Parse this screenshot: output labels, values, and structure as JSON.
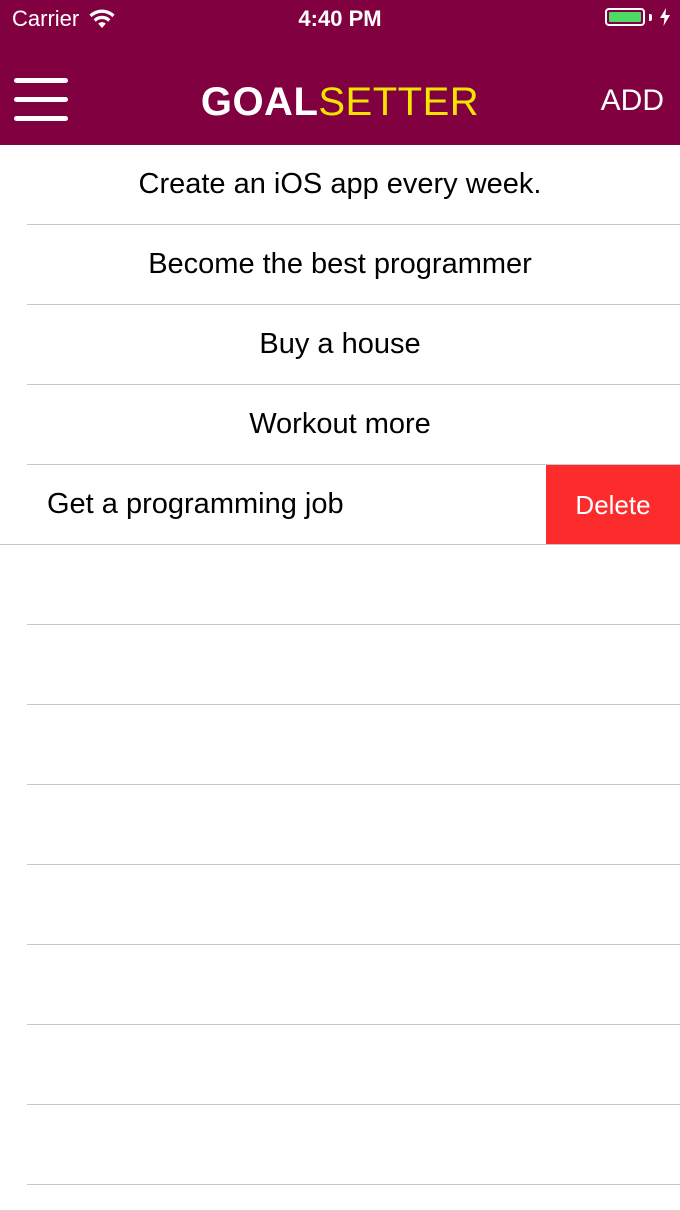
{
  "status_bar": {
    "carrier": "Carrier",
    "time": "4:40 PM",
    "wifi_icon": "wifi-icon",
    "battery_icon": "battery-icon",
    "battery_level": 1.0,
    "battery_color": "#4cd964",
    "charging_icon": "charging-bolt-icon"
  },
  "nav": {
    "menu_icon": "hamburger-menu-icon",
    "title_part_1": "GOAL",
    "title_part_2": "SETTER",
    "add_label": "ADD"
  },
  "colors": {
    "header_background": "#800040",
    "title_accent": "#f5e400",
    "delete_background": "#fc2b2c",
    "separator": "#c8c7cc"
  },
  "goals": [
    {
      "text": "Create an iOS app every week."
    },
    {
      "text": "Become the best programmer"
    },
    {
      "text": "Buy a house"
    },
    {
      "text": "Workout more"
    },
    {
      "text": "Get a programming job",
      "swiped": true,
      "action_label": "Delete"
    }
  ]
}
